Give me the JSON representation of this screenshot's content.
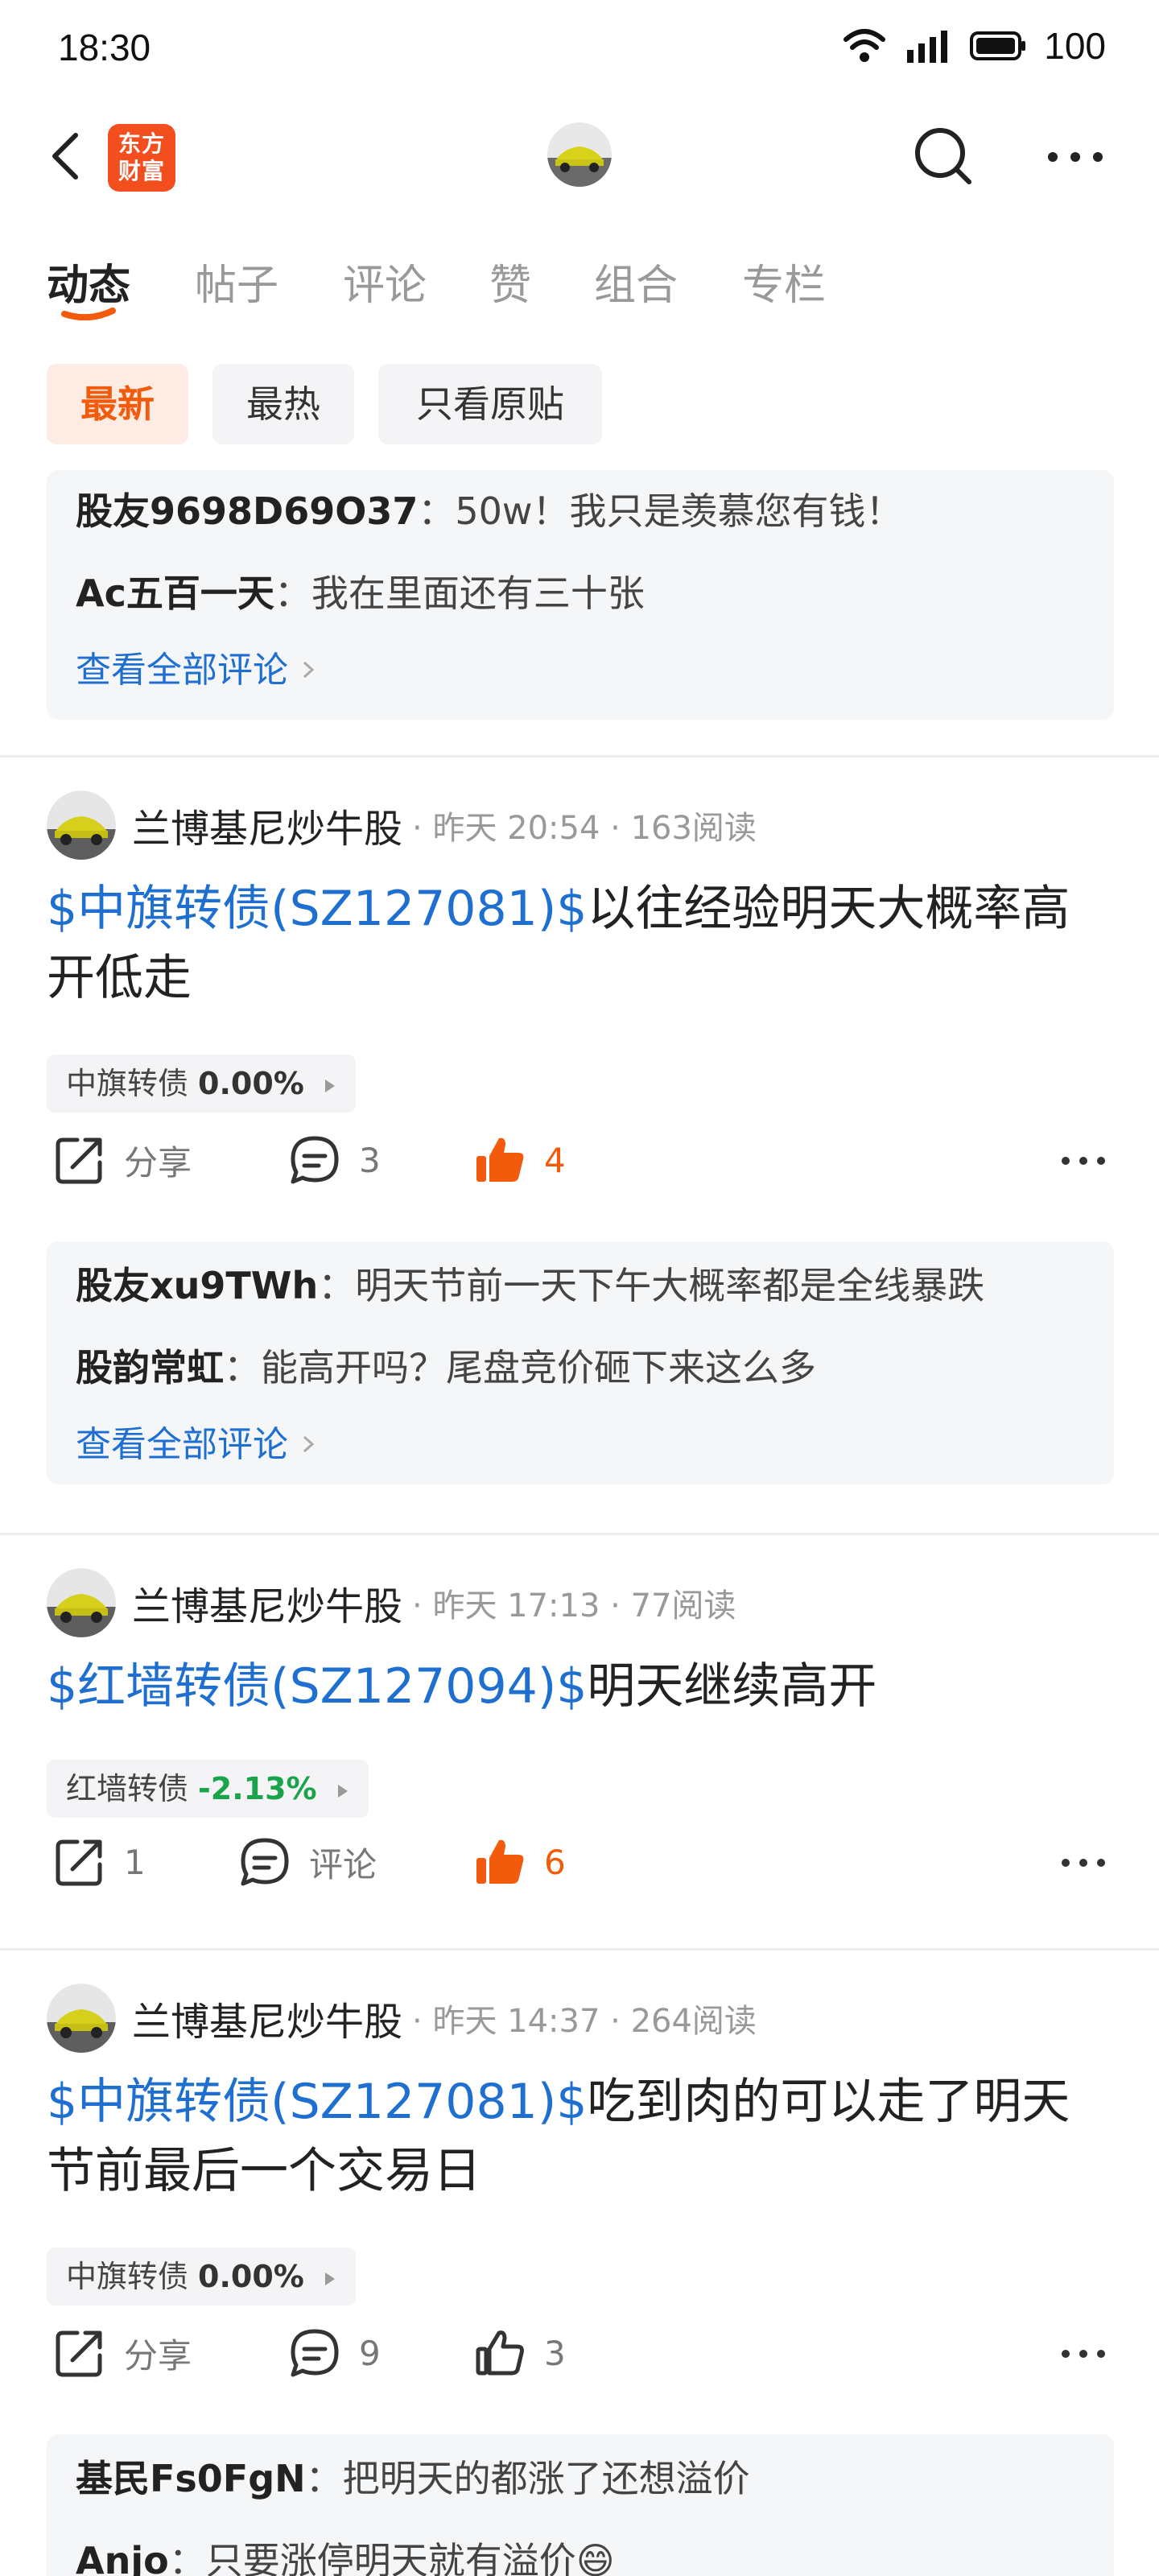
{
  "status": {
    "time": "18:30",
    "battery": "100",
    "network": "5G"
  },
  "header": {
    "logo_text": "东方财富",
    "logo_line1": "东方",
    "logo_line2": "财富"
  },
  "tabs": [
    {
      "label": "动态"
    },
    {
      "label": "帖子"
    },
    {
      "label": "评论"
    },
    {
      "label": "赞"
    },
    {
      "label": "组合"
    },
    {
      "label": "专栏"
    }
  ],
  "filters": [
    {
      "label": "最新"
    },
    {
      "label": "最热"
    },
    {
      "label": "只看原贴"
    }
  ],
  "top_comments": {
    "items": [
      {
        "user": "股友9698D69O37",
        "sep": "：",
        "text": "50w！我只是羡慕您有钱！"
      },
      {
        "user": "Ac五百一天",
        "sep": "：",
        "text": "我在里面还有三十张"
      }
    ],
    "view_all": "查看全部评论"
  },
  "posts": [
    {
      "author": "兰博基尼炒牛股",
      "meta": "· 昨天 20:54 · 163阅读",
      "stock_link": "$中旗转债(SZ127081)$",
      "text": "以往经验明天大概率高开低走",
      "chip_name": "中旗转债",
      "chip_value": "0.00%",
      "share": "分享",
      "comments": "3",
      "likes": "4",
      "comment_items": [
        {
          "user": "股友xu9TWh",
          "sep": "：",
          "text": "明天节前一天下午大概率都是全线暴跌"
        },
        {
          "user": "股韵常虹",
          "sep": "：",
          "text": "能高开吗？尾盘竞价砸下来这么多"
        }
      ],
      "view_all": "查看全部评论"
    },
    {
      "author": "兰博基尼炒牛股",
      "meta": "· 昨天 17:13 · 77阅读",
      "stock_link": "$红墙转债(SZ127094)$",
      "text": "明天继续高开",
      "chip_name": "红墙转债",
      "chip_value": "-2.13%",
      "share": "1",
      "comments": "评论",
      "likes": "6"
    },
    {
      "author": "兰博基尼炒牛股",
      "meta": "· 昨天 14:37 · 264阅读",
      "stock_link": "$中旗转债(SZ127081)$",
      "text": "吃到肉的可以走了明天节前最后一个交易日",
      "chip_name": "中旗转债",
      "chip_value": "0.00%",
      "share": "分享",
      "comments": "9",
      "likes": "3",
      "comment_items": [
        {
          "user": "基民Fs0FgN",
          "sep": "：",
          "text": "把明天的都涨了还想溢价"
        },
        {
          "user": "Anjo",
          "sep": "：",
          "text": "只要涨停明天就有溢价😄"
        }
      ]
    }
  ],
  "colors": {
    "accent": "#f25a0c",
    "link": "#1e6fd0",
    "up_green": "#19a34a"
  }
}
